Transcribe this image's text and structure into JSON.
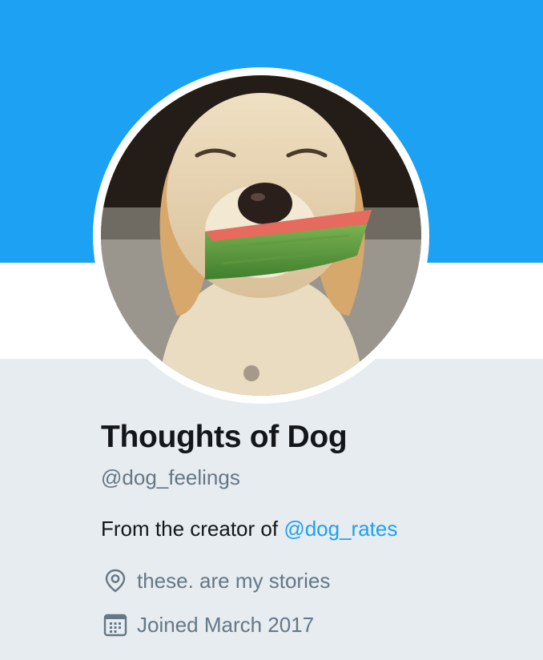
{
  "profile": {
    "display_name": "Thoughts of Dog",
    "handle": "@dog_feelings",
    "bio_prefix": "From the creator of ",
    "bio_mention": "@dog_rates",
    "location": "these. are my stories",
    "joined": "Joined March 2017"
  },
  "icons": {
    "location": "location-pin-icon",
    "joined": "calendar-icon"
  },
  "colors": {
    "banner": "#1da1f2",
    "link": "#1da1f2",
    "name_text": "#14171a",
    "secondary_text": "#657786",
    "background": "#e6ecf0"
  }
}
